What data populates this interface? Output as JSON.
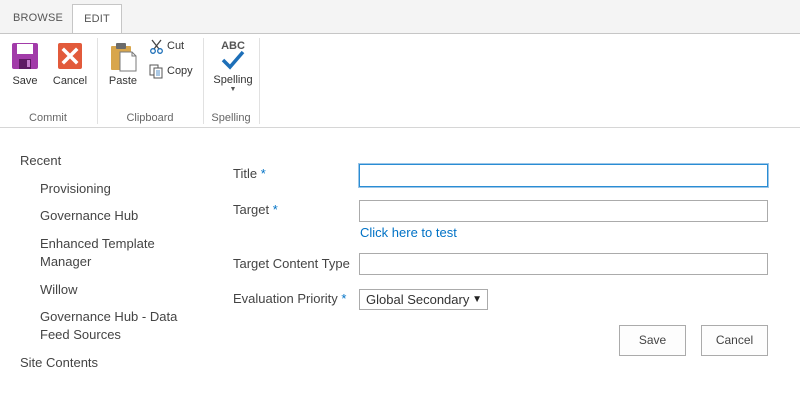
{
  "tabs": {
    "browse": "BROWSE",
    "edit": "EDIT"
  },
  "ribbon": {
    "commit": {
      "save": "Save",
      "cancel": "Cancel",
      "group": "Commit"
    },
    "clipboard": {
      "paste": "Paste",
      "cut": "Cut",
      "copy": "Copy",
      "group": "Clipboard"
    },
    "spelling": {
      "spelling": "Spelling",
      "group": "Spelling",
      "abc": "ABC"
    }
  },
  "nav": {
    "items": [
      {
        "label": "Recent"
      },
      {
        "label": "Provisioning"
      },
      {
        "label": "Governance Hub"
      },
      {
        "label": "Enhanced Template Manager"
      },
      {
        "label": "Willow"
      },
      {
        "label": "Governance Hub - Data Feed Sources"
      },
      {
        "label": "Site Contents"
      }
    ]
  },
  "form": {
    "title_label": "Title",
    "target_label": "Target",
    "target_link": "Click here to test",
    "content_type_label": "Target Content Type",
    "priority_label": "Evaluation Priority",
    "required_mark": "*",
    "priority_value": "Global Secondary",
    "title_value": "",
    "target_value": "",
    "content_type_value": ""
  },
  "buttons": {
    "save": "Save",
    "cancel": "Cancel"
  },
  "colors": {
    "accent": "#0072c6",
    "save_icon": "#a23ba9",
    "cancel_icon": "#e25a3b"
  },
  "icons": [
    "save-icon",
    "cancel-icon",
    "paste-icon",
    "cut-icon",
    "copy-icon",
    "spelling-icon"
  ]
}
